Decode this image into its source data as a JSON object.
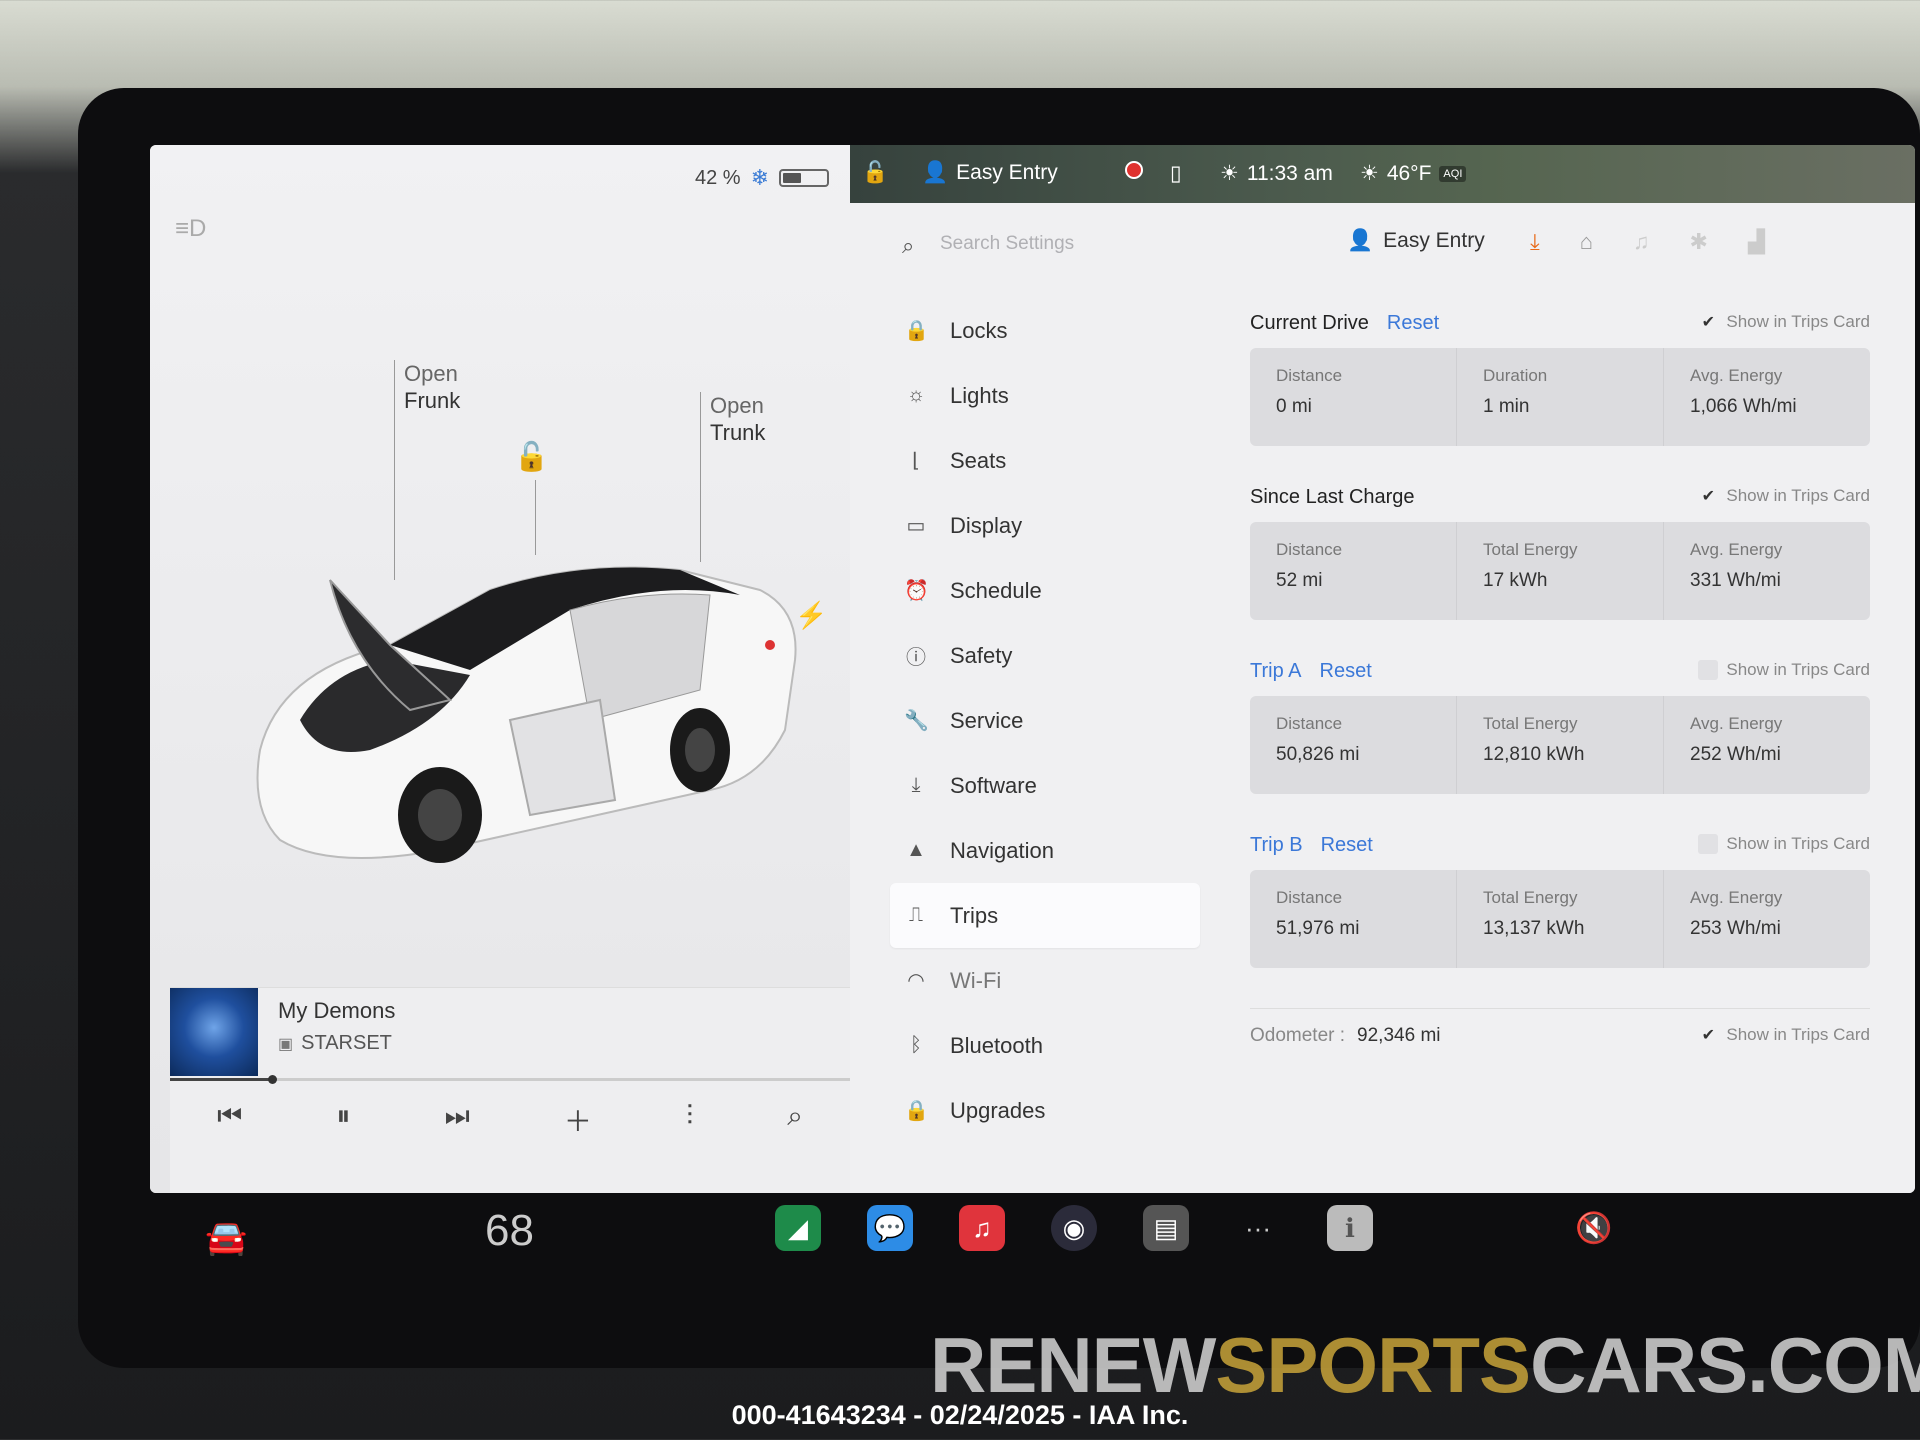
{
  "status": {
    "battery_percent": "42 %",
    "profile_name": "Easy Entry",
    "time": "11:33 am",
    "temperature": "46°F",
    "aqi": "AQI"
  },
  "car": {
    "frunk_line1": "Open",
    "frunk_line2": "Frunk",
    "trunk_line1": "Open",
    "trunk_line2": "Trunk"
  },
  "media": {
    "song": "My Demons",
    "artist": "STARSET",
    "progress": 0.15
  },
  "settings": {
    "search_placeholder": "Search Settings",
    "profile_name": "Easy Entry",
    "menu": [
      {
        "label": "Locks",
        "icon": "lock-icon"
      },
      {
        "label": "Lights",
        "icon": "light-icon"
      },
      {
        "label": "Seats",
        "icon": "seat-icon"
      },
      {
        "label": "Display",
        "icon": "display-icon"
      },
      {
        "label": "Schedule",
        "icon": "schedule-icon"
      },
      {
        "label": "Safety",
        "icon": "safety-icon"
      },
      {
        "label": "Service",
        "icon": "wrench-icon"
      },
      {
        "label": "Software",
        "icon": "download-icon"
      },
      {
        "label": "Navigation",
        "icon": "navigation-icon"
      },
      {
        "label": "Trips",
        "icon": "trips-icon"
      },
      {
        "label": "Wi-Fi",
        "icon": "wifi-icon"
      },
      {
        "label": "Bluetooth",
        "icon": "bluetooth-icon"
      },
      {
        "label": "Upgrades",
        "icon": "upgrades-icon"
      }
    ],
    "active_item": "Trips"
  },
  "trips": {
    "show_label": "Show in Trips Card",
    "reset_label": "Reset",
    "current_drive": {
      "title": "Current Drive",
      "checked": true,
      "stats": [
        {
          "label": "Distance",
          "value": "0 mi"
        },
        {
          "label": "Duration",
          "value": "1 min"
        },
        {
          "label": "Avg. Energy",
          "value": "1,066 Wh/mi"
        }
      ]
    },
    "since_last_charge": {
      "title": "Since Last Charge",
      "checked": true,
      "stats": [
        {
          "label": "Distance",
          "value": "52 mi"
        },
        {
          "label": "Total Energy",
          "value": "17 kWh"
        },
        {
          "label": "Avg. Energy",
          "value": "331 Wh/mi"
        }
      ]
    },
    "trip_a": {
      "title": "Trip A",
      "checked": false,
      "stats": [
        {
          "label": "Distance",
          "value": "50,826 mi"
        },
        {
          "label": "Total Energy",
          "value": "12,810 kWh"
        },
        {
          "label": "Avg. Energy",
          "value": "252 Wh/mi"
        }
      ]
    },
    "trip_b": {
      "title": "Trip B",
      "checked": false,
      "stats": [
        {
          "label": "Distance",
          "value": "51,976 mi"
        },
        {
          "label": "Total Energy",
          "value": "13,137 kWh"
        },
        {
          "label": "Avg. Energy",
          "value": "253 Wh/mi"
        }
      ]
    },
    "odometer_label": "Odometer :",
    "odometer_value": "92,346 mi",
    "odometer_checked": true
  },
  "dock": {
    "temperature": "68"
  },
  "watermark": {
    "part1": "RENEW",
    "part2": "SPORTS",
    "part3": "CARS.COM"
  },
  "caption": "000-41643234 - 02/24/2025 - IAA Inc."
}
